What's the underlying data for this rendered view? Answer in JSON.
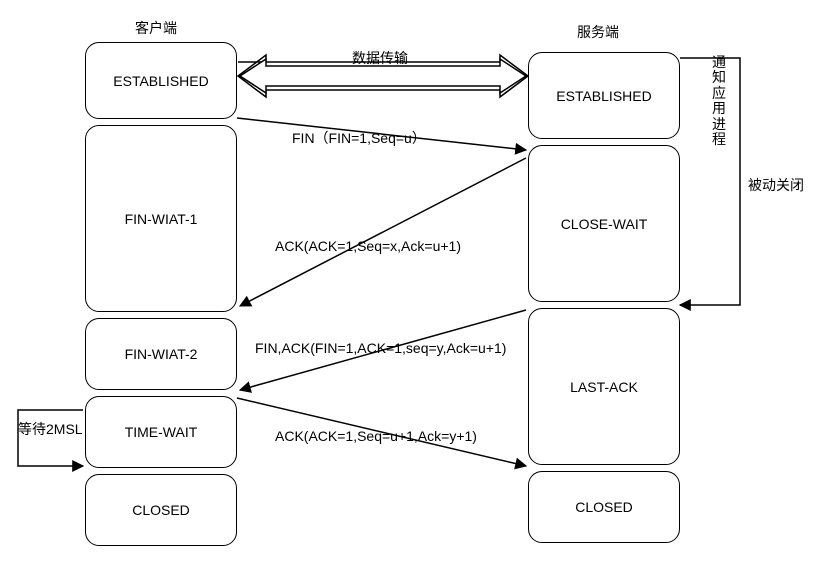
{
  "header": {
    "client": "客户端",
    "server": "服务端"
  },
  "client": {
    "s1": "ESTABLISHED",
    "s2": "FIN-WIAT-1",
    "s3": "FIN-WIAT-2",
    "s4": "TIME-WAIT",
    "s5": "CLOSED"
  },
  "server": {
    "s1": "ESTABLISHED",
    "s2": "CLOSE-WAIT",
    "s3": "LAST-ACK",
    "s4": "CLOSED"
  },
  "messages": {
    "data_transfer": "数据传输",
    "fin": "FIN（FIN=1,Seq=u）",
    "ack1": "ACK(ACK=1,Seq=x,Ack=u+1)",
    "finack": "FIN,ACK(FIN=1,ACK=1,seq=y,Ack=u+1)",
    "ack2": "ACK(ACK=1,Seq=u+1,Ack=y+1)"
  },
  "notes": {
    "notify_app": "通知应用进程",
    "passive_close": "被动关闭",
    "wait_2msl": "等待2MSL"
  }
}
